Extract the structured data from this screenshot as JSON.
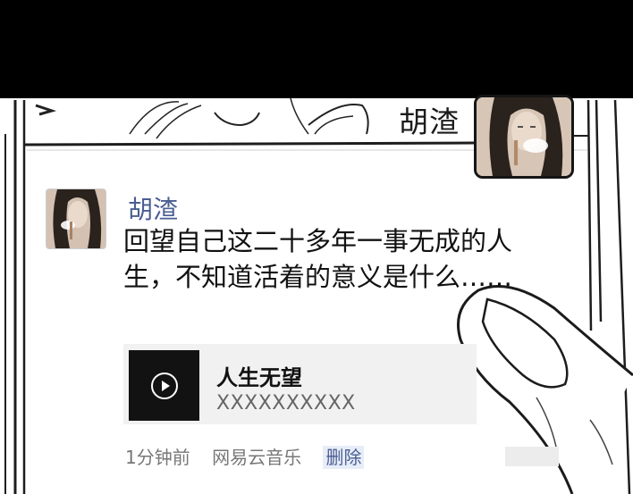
{
  "header": {
    "contact_name": "胡渣"
  },
  "post": {
    "username": "胡渣",
    "text": "回望自己这二十多年一事无成的人生，不知道活着的意义是什么……"
  },
  "music_card": {
    "title": "人生无望",
    "artist": "XXXXXXXXXX",
    "cover_icon": "play-icon"
  },
  "meta": {
    "time": "1分钟前",
    "source": "网易云音乐",
    "delete_label": "删除"
  },
  "colors": {
    "username": "#4a5d93",
    "top_bar": "#000000"
  }
}
